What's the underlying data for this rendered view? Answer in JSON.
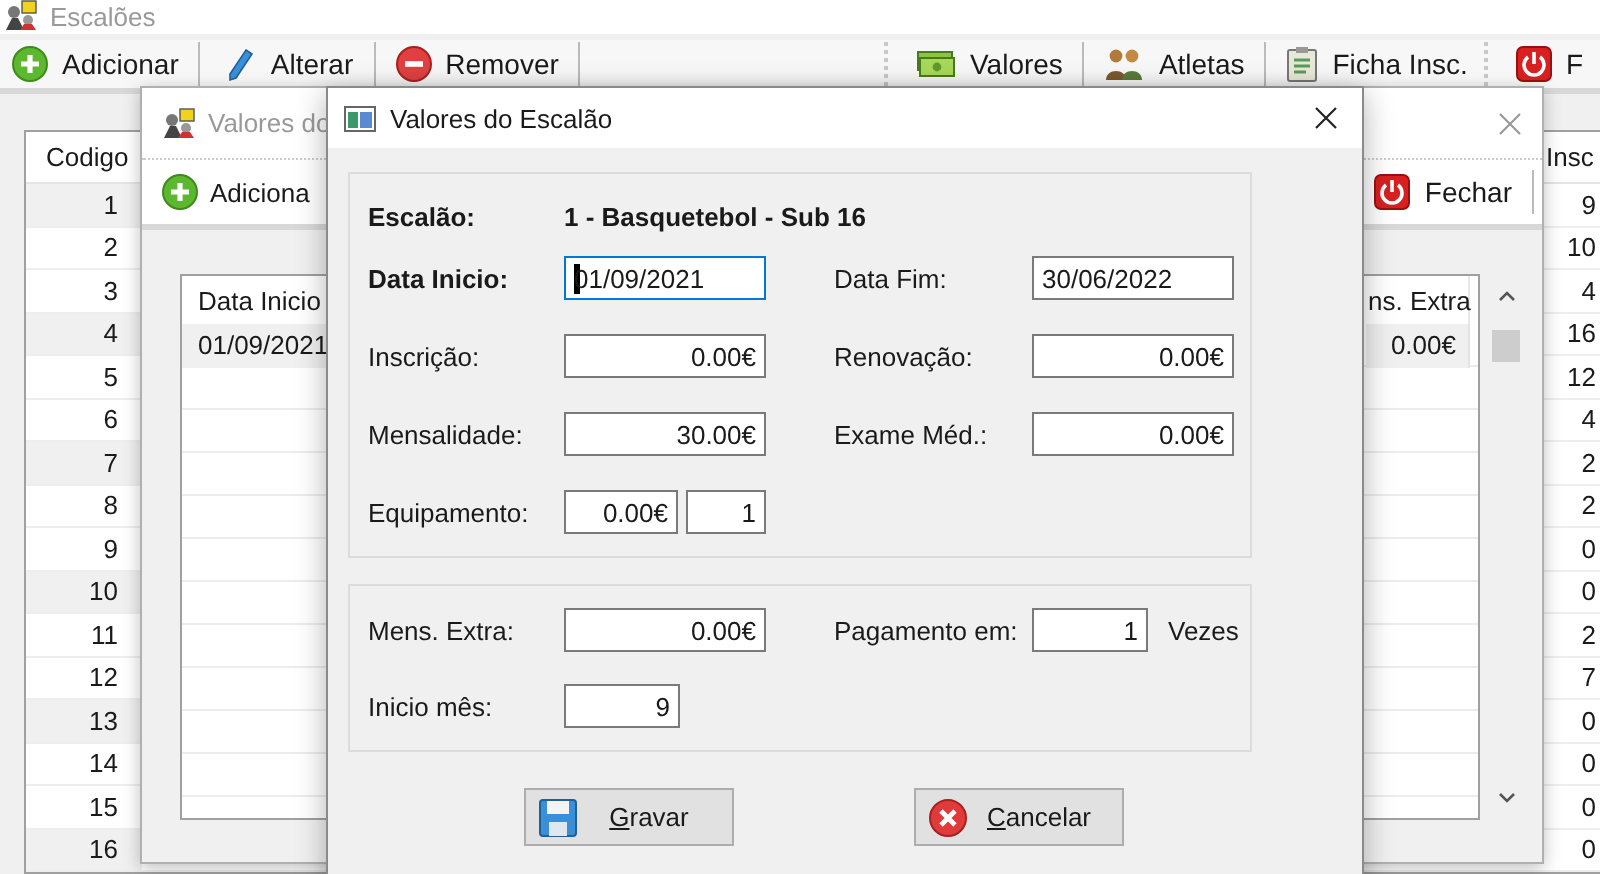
{
  "main_window": {
    "title": "Escalões",
    "toolbar": [
      "Adicionar",
      "Alterar",
      "Remover",
      "Valores",
      "Atletas",
      "Ficha Insc.",
      "F"
    ],
    "table": {
      "columns": [
        "Codigo",
        "Insc"
      ],
      "rows": [
        [
          "1",
          "9"
        ],
        [
          "2",
          "10"
        ],
        [
          "3",
          "4"
        ],
        [
          "4",
          "16"
        ],
        [
          "5",
          "12"
        ],
        [
          "6",
          "4"
        ],
        [
          "7",
          "2"
        ],
        [
          "8",
          "2"
        ],
        [
          "9",
          "0"
        ],
        [
          "10",
          "0"
        ],
        [
          "11",
          "2"
        ],
        [
          "12",
          "7"
        ],
        [
          "13",
          "0"
        ],
        [
          "14",
          "0"
        ],
        [
          "15",
          "0"
        ],
        [
          "16",
          "0"
        ]
      ]
    }
  },
  "back_window": {
    "title": "Valores do",
    "toolbar": [
      "Adiciona",
      "Fechar"
    ],
    "table": {
      "columns": [
        "Data Inicio",
        "ns. Extra"
      ],
      "rows": [
        [
          "01/09/2021",
          "0.00€"
        ]
      ]
    }
  },
  "dialog": {
    "title": "Valores do Escalão",
    "escalao": {
      "label": "Escalão:",
      "value": "1 - Basquetebol - Sub 16"
    },
    "groups": [
      {
        "rows": [
          [
            {
              "label": "Data Inicio:",
              "value": "01/09/2021",
              "kind": "date",
              "focused": true
            },
            {
              "label": "Data Fim:",
              "value": "30/06/2022",
              "kind": "date",
              "focused": false
            }
          ],
          [
            {
              "label": "Inscrição:",
              "value": "0.00€",
              "kind": "money",
              "focused": false
            },
            {
              "label": "Renovação:",
              "value": "0.00€",
              "kind": "money",
              "focused": false
            }
          ],
          [
            {
              "label": "Mensalidade:",
              "value": "30.00€",
              "kind": "money",
              "focused": false
            },
            {
              "label": "Exame Méd.:",
              "value": "0.00€",
              "kind": "money",
              "focused": false
            }
          ],
          [
            {
              "label": "Equipamento:",
              "value": "0.00€",
              "quantity": "1",
              "kind": "money",
              "focused": false
            }
          ]
        ]
      },
      {
        "rows": [
          [
            {
              "label": "Mens. Extra:",
              "value": "0.00€",
              "kind": "money",
              "focused": false
            },
            {
              "label": "Pagamento em:",
              "value": "1",
              "unit": "Vezes",
              "kind": "number",
              "focused": false
            }
          ],
          [
            {
              "label": "Inicio mês:",
              "value": "9",
              "kind": "number",
              "focused": false
            }
          ]
        ]
      }
    ],
    "buttons": [
      "Gravar",
      "Cancelar"
    ]
  }
}
